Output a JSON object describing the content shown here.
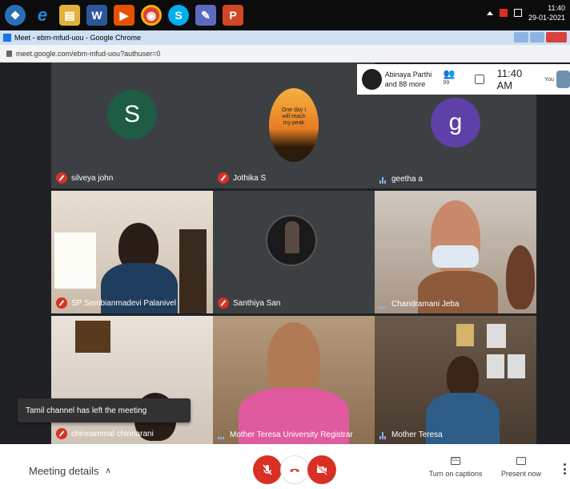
{
  "taskbar": {
    "apps": [
      {
        "icon": "windows-start-icon",
        "glyph": "❖",
        "color": "#2a6fb5"
      },
      {
        "icon": "internet-explorer-icon",
        "glyph": "e",
        "color": "#1e88e5"
      },
      {
        "icon": "file-explorer-icon",
        "glyph": "▤",
        "color": "#e2b13c"
      },
      {
        "icon": "word-icon",
        "glyph": "W",
        "color": "#2b579a"
      },
      {
        "icon": "media-player-icon",
        "glyph": "▶",
        "color": "#e65100"
      },
      {
        "icon": "chrome-icon",
        "glyph": "◉",
        "color": "#db4437"
      },
      {
        "icon": "skype-icon",
        "glyph": "S",
        "color": "#00aff0"
      },
      {
        "icon": "paint-icon",
        "glyph": "✎",
        "color": "#5c6bc0"
      },
      {
        "icon": "powerpoint-icon",
        "glyph": "P",
        "color": "#d24726"
      }
    ],
    "clock_time": "11:40",
    "clock_date": "29-01-2021"
  },
  "browser": {
    "tab_title": "Meet - ebm-mfud-uou - Google Chrome",
    "url": "meet.google.com/ebm-mfud-uou?authuser=0"
  },
  "topbar": {
    "presenter_line1": "Abinaya Parthi",
    "presenter_line2": "and 88 more",
    "people_count": "99",
    "time": "11:40 AM",
    "self_label": "You"
  },
  "tiles": [
    {
      "name": "silveya john",
      "mic": "off",
      "avatar_letter": "S",
      "avatar_color": "#1e5c44"
    },
    {
      "name": "Jothika S",
      "mic": "off",
      "avatar_text": "One day I will reach my peak"
    },
    {
      "name": "geetha a",
      "mic": "speaking",
      "avatar_letter": "g",
      "avatar_color": "#5f3fa8"
    },
    {
      "name": "SP Sembianmadevi Palanivel",
      "mic": "off"
    },
    {
      "name": "Santhiya San",
      "mic": "off"
    },
    {
      "name": "Chandramani Jeba",
      "mic": "speaking"
    },
    {
      "name": "chinnammal chinnarani",
      "mic": "off"
    },
    {
      "name": "Mother Teresa University Registrar",
      "mic": "speaking"
    },
    {
      "name": "Mother Teresa",
      "mic": "speaking"
    }
  ],
  "toast": "Tamil channel has left the meeting",
  "bottom": {
    "meeting_details": "Meeting details",
    "captions_label": "Turn on captions",
    "captions_box": "CC",
    "present_label": "Present now"
  },
  "colors": {
    "meet_red": "#d93025",
    "stage_bg": "#202124",
    "speak_blue": "#8ab4f8"
  }
}
